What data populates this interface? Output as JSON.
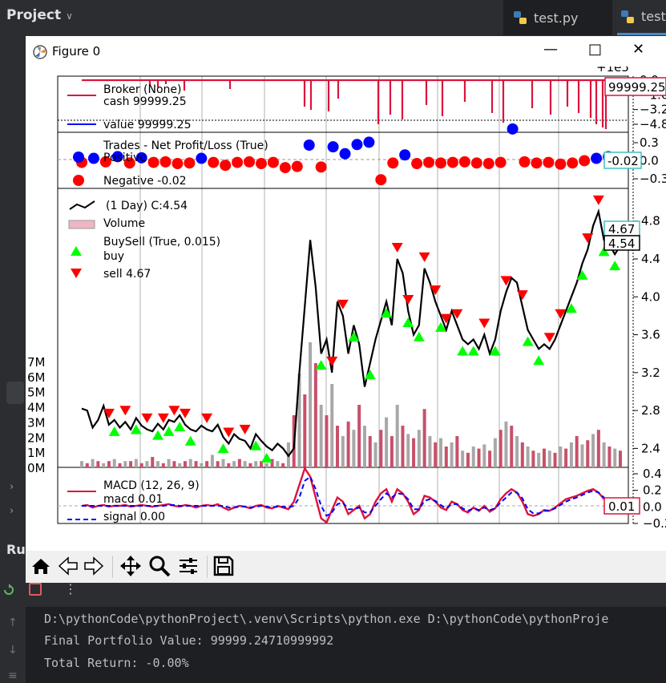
{
  "ide": {
    "project_label": "Project",
    "tabs": [
      {
        "label": "test.py"
      },
      {
        "label": "test"
      }
    ],
    "run_label": "Ru"
  },
  "figure": {
    "title": "Figure 0"
  },
  "console": {
    "lines": [
      "D:\\pythonCode\\pythonProject\\.venv\\Scripts\\python.exe D:\\pythonCode\\pythonProje",
      "Final Portfolio Value: 99999.24710999992",
      "Total Return: -0.00%"
    ]
  },
  "colors": {
    "crimson": "#dc143c",
    "blue": "#0000ff",
    "red": "#ff0000",
    "lime": "#00ff00",
    "gray": "#aaaaaa",
    "turquoise": "#40c0c0"
  },
  "chart_data": [
    {
      "type": "line",
      "panel": "broker",
      "offset_label": "+1e5",
      "legend": [
        "Broker (None)",
        "cash 99999.25",
        "value 99999.25"
      ],
      "y_ticks": [
        "0.0",
        "−1.6",
        "−3.2",
        "−4.8"
      ],
      "last_value_label": "99999.25",
      "series": [
        {
          "name": "cash 99999.25",
          "color": "#dc143c"
        },
        {
          "name": "value 99999.25",
          "color": "#0000ff"
        }
      ]
    },
    {
      "type": "scatter",
      "panel": "trades",
      "legend": [
        "Trades - Net Profit/Loss (True)",
        "Positive",
        "Negative -0.02"
      ],
      "y_ticks": [
        "0.3",
        "0.0",
        "−0.3"
      ],
      "last_value_label": "-0.02",
      "positive": [
        [
          1,
          0.02
        ],
        [
          3,
          0.05
        ],
        [
          5,
          0.03
        ],
        [
          10,
          0.02
        ],
        [
          19,
          0.25
        ],
        [
          21,
          0.22
        ],
        [
          22,
          0.1
        ],
        [
          23,
          0.26
        ],
        [
          24,
          0.3
        ],
        [
          27,
          0.08
        ],
        [
          36,
          0.53
        ],
        [
          43,
          0.02
        ],
        [
          44,
          0.05
        ]
      ],
      "negative": [
        [
          0,
          -0.05
        ],
        [
          2,
          -0.04
        ],
        [
          4,
          -0.06
        ],
        [
          6,
          -0.05
        ],
        [
          7,
          -0.04
        ],
        [
          8,
          -0.07
        ],
        [
          9,
          -0.06
        ],
        [
          11,
          -0.05
        ],
        [
          12,
          -0.1
        ],
        [
          13,
          -0.05
        ],
        [
          14,
          -0.04
        ],
        [
          15,
          -0.07
        ],
        [
          16,
          -0.05
        ],
        [
          17,
          -0.14
        ],
        [
          18,
          -0.12
        ],
        [
          20,
          -0.13
        ],
        [
          25,
          -0.35
        ],
        [
          26,
          -0.06
        ],
        [
          28,
          -0.07
        ],
        [
          29,
          -0.05
        ],
        [
          30,
          -0.06
        ],
        [
          31,
          -0.05
        ],
        [
          32,
          -0.04
        ],
        [
          33,
          -0.06
        ],
        [
          34,
          -0.07
        ],
        [
          35,
          -0.05
        ],
        [
          37,
          -0.04
        ],
        [
          38,
          -0.06
        ],
        [
          39,
          -0.05
        ],
        [
          40,
          -0.08
        ],
        [
          41,
          -0.06
        ],
        [
          42,
          -0.02
        ]
      ]
    },
    {
      "type": "line",
      "panel": "price",
      "legend": [
        "(1 Day) C:4.54",
        "Volume",
        "BuySell (True, 0.015)",
        "buy",
        "sell 4.67"
      ],
      "y_ticks": [
        "4.8",
        "4.4",
        "4.0",
        "3.6",
        "3.2",
        "2.8",
        "2.4"
      ],
      "volume_ticks": [
        "7M",
        "6M",
        "5M",
        "4M",
        "3M",
        "2M",
        "1M",
        "0M"
      ],
      "last_value_labels": [
        "4.67",
        "4.54"
      ],
      "close": [
        2.82,
        2.8,
        2.62,
        2.7,
        2.85,
        2.65,
        2.7,
        2.62,
        2.68,
        2.6,
        2.72,
        2.64,
        2.6,
        2.58,
        2.66,
        2.6,
        2.7,
        2.68,
        2.75,
        2.65,
        2.6,
        2.58,
        2.64,
        2.6,
        2.58,
        2.65,
        2.52,
        2.45,
        2.55,
        2.5,
        2.48,
        2.4,
        2.55,
        2.48,
        2.42,
        2.38,
        2.45,
        2.4,
        2.32,
        2.4,
        3.2,
        3.9,
        4.6,
        4.1,
        3.4,
        3.55,
        3.2,
        3.95,
        3.8,
        3.4,
        3.7,
        3.5,
        3.05,
        3.3,
        3.55,
        3.75,
        3.95,
        3.7,
        4.4,
        4.25,
        3.85,
        3.6,
        3.7,
        4.3,
        4.15,
        3.95,
        3.8,
        3.65,
        3.85,
        3.7,
        3.55,
        3.5,
        3.55,
        3.45,
        3.6,
        3.4,
        3.55,
        3.85,
        4.05,
        4.2,
        4.15,
        3.9,
        3.65,
        3.55,
        3.45,
        3.5,
        3.45,
        3.55,
        3.7,
        3.85,
        4.0,
        4.15,
        4.35,
        4.5,
        4.75,
        4.9,
        4.6,
        4.55,
        4.45,
        4.54
      ],
      "buy_idx": [
        6,
        10,
        14,
        16,
        18,
        20,
        26,
        32,
        34,
        44,
        50,
        53,
        56,
        60,
        62,
        66,
        70,
        72,
        76,
        82,
        84,
        90,
        92,
        96,
        98
      ],
      "sell_idx": [
        5,
        8,
        12,
        15,
        17,
        19,
        23,
        27,
        30,
        46,
        48,
        58,
        60,
        63,
        65,
        67,
        69,
        74,
        78,
        81,
        86,
        88,
        93,
        95,
        97
      ],
      "volume": [
        0.3,
        0.2,
        0.4,
        0.3,
        0.2,
        0.3,
        0.4,
        0.2,
        0.3,
        0.3,
        0.4,
        0.2,
        0.3,
        0.5,
        0.3,
        0.2,
        0.4,
        0.3,
        0.2,
        0.3,
        0.4,
        0.3,
        0.2,
        0.3,
        0.6,
        0.3,
        0.4,
        0.2,
        0.3,
        0.4,
        0.3,
        0.2,
        0.3,
        0.3,
        0.2,
        0.4,
        0.3,
        0.2,
        1.2,
        2.5,
        4.5,
        3.5,
        6.0,
        5.0,
        3.0,
        2.5,
        4.0,
        2.0,
        1.5,
        2.2,
        1.8,
        3.0,
        2.0,
        1.5,
        1.2,
        1.8,
        2.4,
        1.5,
        3.0,
        2.0,
        1.6,
        1.4,
        1.8,
        2.8,
        1.5,
        1.2,
        1.4,
        1.0,
        1.2,
        1.5,
        0.8,
        0.7,
        1.0,
        0.9,
        1.1,
        0.8,
        1.4,
        1.8,
        2.2,
        2.0,
        1.5,
        1.2,
        1.0,
        0.8,
        0.7,
        0.9,
        0.8,
        0.7,
        1.0,
        0.9,
        1.2,
        1.5,
        1.1,
        1.3,
        1.6,
        1.8,
        1.2,
        1.0,
        0.9,
        0.8
      ]
    },
    {
      "type": "line",
      "panel": "macd",
      "legend": [
        "MACD (12, 26, 9)",
        "macd 0.01",
        "signal 0.00"
      ],
      "y_ticks": [
        "0.4",
        "0.2",
        "0.0",
        "−0.2"
      ],
      "last_value_label": "0.01",
      "macd": [
        0.0,
        0.01,
        -0.02,
        0.0,
        0.01,
        -0.01,
        0.0,
        0.0,
        0.01,
        -0.01,
        0.0,
        0.01,
        0.0,
        -0.01,
        0.0,
        0.01,
        0.02,
        0.0,
        -0.01,
        0.01,
        0.0,
        -0.02,
        0.0,
        0.01,
        0.0,
        0.02,
        -0.02,
        -0.05,
        -0.02,
        0.0,
        -0.01,
        -0.03,
        0.0,
        0.01,
        -0.02,
        -0.03,
        0.0,
        -0.02,
        -0.04,
        0.05,
        0.25,
        0.45,
        0.35,
        0.1,
        -0.15,
        -0.2,
        -0.05,
        0.1,
        0.05,
        -0.1,
        -0.05,
        0.0,
        -0.15,
        -0.1,
        0.05,
        0.15,
        0.2,
        0.05,
        0.2,
        0.15,
        0.05,
        -0.1,
        -0.05,
        0.12,
        0.1,
        0.05,
        -0.02,
        -0.05,
        0.05,
        0.02,
        -0.05,
        -0.08,
        -0.02,
        -0.06,
        0.0,
        -0.07,
        -0.03,
        0.08,
        0.15,
        0.2,
        0.16,
        0.05,
        -0.1,
        -0.12,
        -0.1,
        -0.05,
        -0.06,
        -0.02,
        0.03,
        0.08,
        0.1,
        0.12,
        0.15,
        0.18,
        0.2,
        0.16,
        0.08,
        0.05,
        0.03,
        0.01
      ],
      "signal": [
        0.0,
        0.0,
        0.0,
        0.0,
        0.0,
        0.0,
        0.0,
        0.0,
        0.0,
        0.0,
        0.0,
        0.0,
        0.0,
        0.0,
        0.0,
        0.0,
        0.01,
        0.01,
        0.0,
        0.0,
        0.0,
        0.0,
        0.0,
        0.0,
        0.0,
        0.0,
        0.0,
        -0.02,
        -0.02,
        -0.01,
        -0.01,
        -0.02,
        -0.01,
        0.0,
        -0.01,
        -0.02,
        -0.01,
        -0.01,
        -0.02,
        0.0,
        0.1,
        0.3,
        0.35,
        0.2,
        0.0,
        -0.12,
        -0.08,
        0.02,
        0.04,
        -0.04,
        -0.04,
        -0.02,
        -0.08,
        -0.08,
        0.0,
        0.08,
        0.15,
        0.1,
        0.15,
        0.14,
        0.08,
        -0.04,
        -0.04,
        0.06,
        0.08,
        0.06,
        0.01,
        -0.03,
        0.02,
        0.02,
        -0.03,
        -0.06,
        -0.03,
        -0.05,
        -0.02,
        -0.05,
        -0.03,
        0.04,
        0.1,
        0.16,
        0.16,
        0.09,
        -0.04,
        -0.09,
        -0.09,
        -0.06,
        -0.06,
        -0.03,
        0.01,
        0.05,
        0.08,
        0.1,
        0.13,
        0.16,
        0.18,
        0.16,
        0.1,
        0.07,
        0.04,
        0.0
      ]
    }
  ]
}
